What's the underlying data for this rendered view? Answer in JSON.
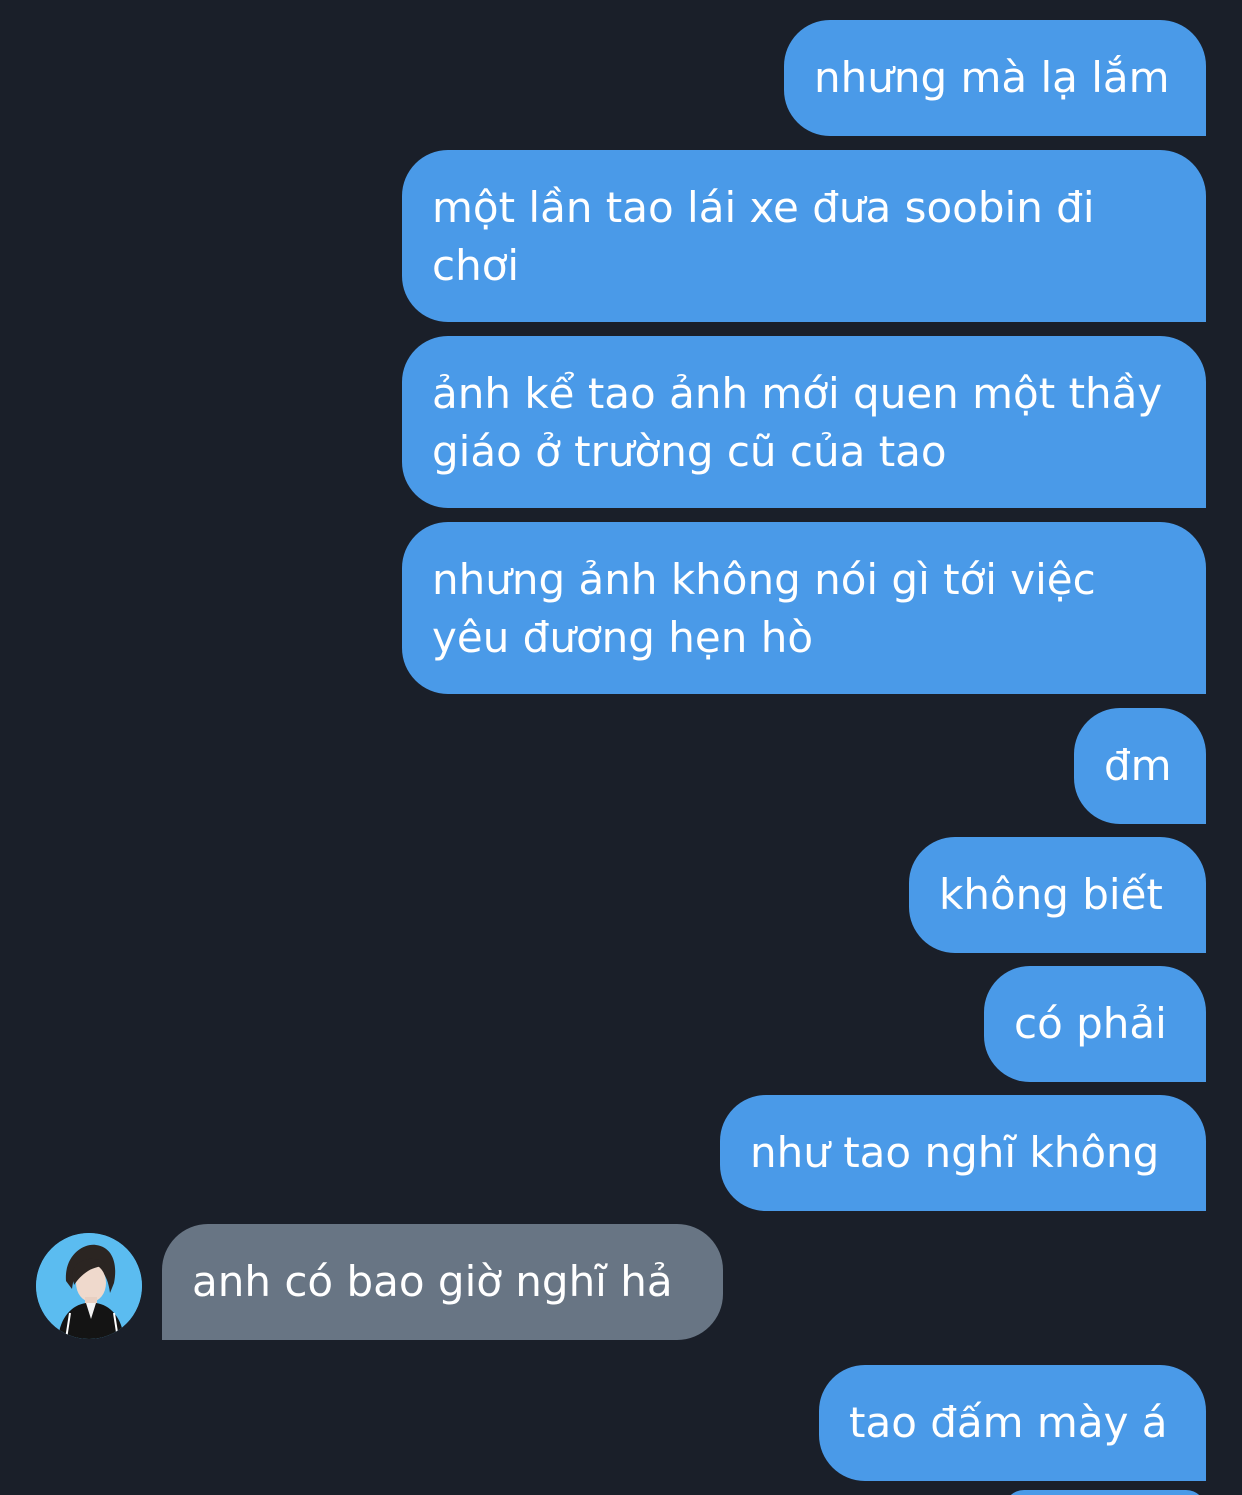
{
  "messages": [
    {
      "side": "sent",
      "text": "nhưng mà lạ lắm"
    },
    {
      "side": "sent",
      "text": "một lần tao lái xe đưa soobin đi chơi"
    },
    {
      "side": "sent",
      "text": "ảnh kể tao ảnh mới quen một thầy giáo ở trường cũ của tao"
    },
    {
      "side": "sent",
      "text": "nhưng ảnh không nói gì tới việc yêu đương hẹn hò"
    },
    {
      "side": "sent",
      "text": "đm"
    },
    {
      "side": "sent",
      "text": "không biết"
    },
    {
      "side": "sent",
      "text": "có phải"
    },
    {
      "side": "sent",
      "text": "như tao nghĩ không"
    },
    {
      "side": "received",
      "text": "anh có bao giờ nghĩ hả"
    },
    {
      "side": "sent",
      "text": "tao đấm mày á"
    }
  ],
  "colors": {
    "background": "#1a1f29",
    "sent_bubble": "#4a9ae8",
    "received_bubble": "#687584",
    "avatar_bg": "#5bbcf0"
  },
  "icons": {
    "avatar": "contact-avatar-photo"
  }
}
